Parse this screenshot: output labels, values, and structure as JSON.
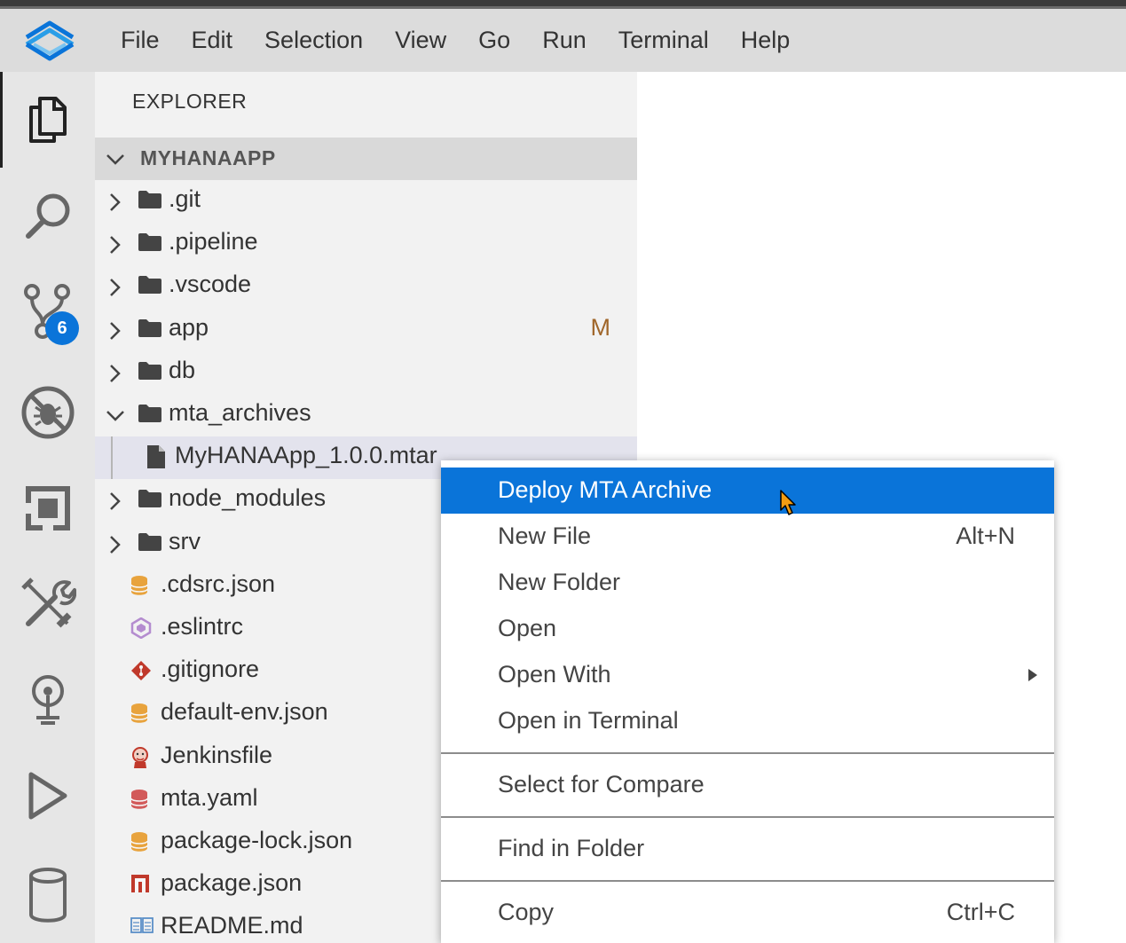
{
  "menubar": {
    "logo": "sap-business-application-studio-logo",
    "items": [
      "File",
      "Edit",
      "Selection",
      "View",
      "Go",
      "Run",
      "Terminal",
      "Help"
    ]
  },
  "activity_bar": {
    "icons": [
      "explorer-icon",
      "search-icon",
      "source-control-icon",
      "no-debug-icon",
      "extensions-icon",
      "tools-icon",
      "cloud-foundry-icon",
      "run-icon",
      "database-icon"
    ],
    "active": "explorer-icon",
    "source_control_badge": "6"
  },
  "explorer": {
    "title": "EXPLORER",
    "project": "MYHANAAPP",
    "tree": [
      {
        "label": ".git",
        "type": "folder",
        "expanded": false
      },
      {
        "label": ".pipeline",
        "type": "folder",
        "expanded": false
      },
      {
        "label": ".vscode",
        "type": "folder",
        "expanded": false
      },
      {
        "label": "app",
        "type": "folder",
        "expanded": false,
        "decoration": "M"
      },
      {
        "label": "db",
        "type": "folder",
        "expanded": false
      },
      {
        "label": "mta_archives",
        "type": "folder",
        "expanded": true
      },
      {
        "label": "MyHANAApp_1.0.0.mtar",
        "type": "file",
        "selected": true
      },
      {
        "label": "node_modules",
        "type": "folder",
        "expanded": false
      },
      {
        "label": "srv",
        "type": "folder",
        "expanded": false
      },
      {
        "label": ".cdsrc.json",
        "type": "json-file"
      },
      {
        "label": ".eslintrc",
        "type": "eslint-file"
      },
      {
        "label": ".gitignore",
        "type": "git-file"
      },
      {
        "label": "default-env.json",
        "type": "json-file"
      },
      {
        "label": "Jenkinsfile",
        "type": "jenkins-file"
      },
      {
        "label": "mta.yaml",
        "type": "yaml-file"
      },
      {
        "label": "package-lock.json",
        "type": "json-file"
      },
      {
        "label": "package.json",
        "type": "npm-file"
      },
      {
        "label": "README.md",
        "type": "markdown-file"
      }
    ]
  },
  "context_menu": {
    "items": [
      {
        "label": "Deploy MTA Archive",
        "highlighted": true
      },
      {
        "label": "New File",
        "shortcut": "Alt+N"
      },
      {
        "label": "New Folder"
      },
      {
        "label": "Open"
      },
      {
        "label": "Open With",
        "submenu": true
      },
      {
        "label": "Open in Terminal"
      },
      {
        "label": "Select for Compare"
      },
      {
        "label": "Find in Folder"
      },
      {
        "label": "Copy",
        "shortcut": "Ctrl+C"
      }
    ]
  },
  "colors": {
    "accent": "#0a74d9",
    "badge": "#0a74d9",
    "modified": "#a0662a",
    "menubar_bg": "#dcdcdc",
    "sidebar_bg": "#f2f2f2"
  }
}
